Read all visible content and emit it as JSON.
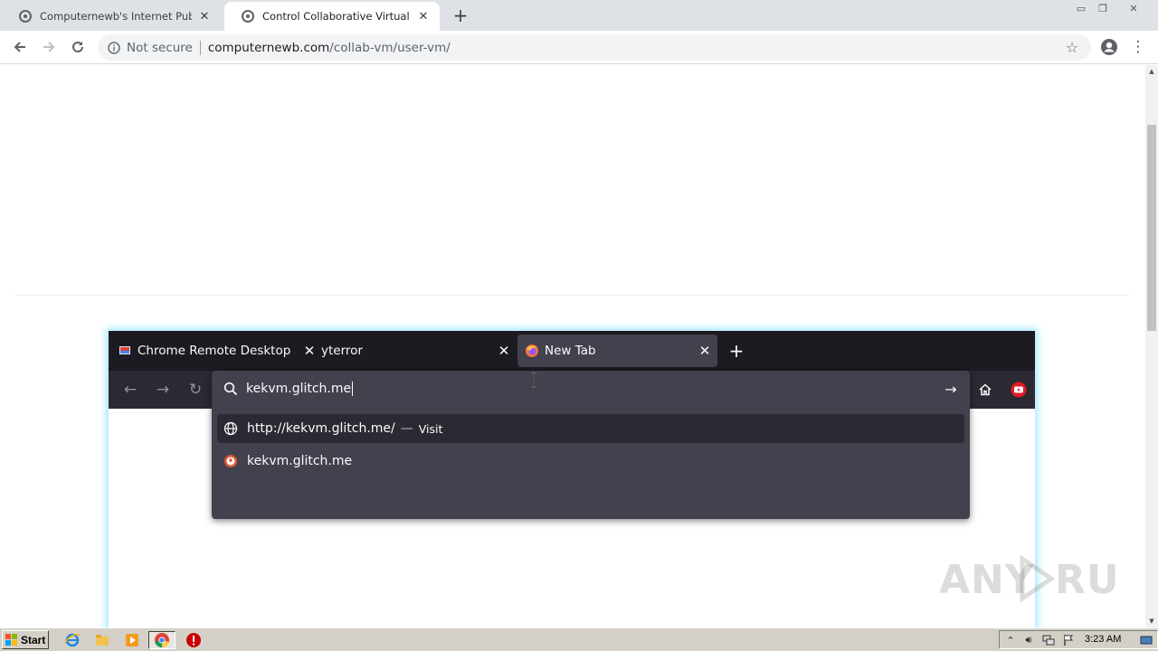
{
  "chrome": {
    "tabs": [
      {
        "title": "Computernewb's Internet Pub Hub",
        "active": false
      },
      {
        "title": "Control Collaborative Virtual Machine",
        "active": true
      }
    ],
    "security": "Not secure",
    "url_host": "computernewb.com",
    "url_path": "/collab-vm/user-vm/"
  },
  "vm": {
    "firefox": {
      "tabs": [
        {
          "title": "Chrome Remote Desktop"
        },
        {
          "title": "yterror"
        },
        {
          "title": "New Tab",
          "selected": true
        }
      ],
      "address_text": "kekvm.glitch.me",
      "suggestions": [
        {
          "text": "http://kekvm.glitch.me/",
          "action": "Visit"
        },
        {
          "text": "kekvm.glitch.me"
        }
      ]
    }
  },
  "taskbar": {
    "start_label": "Start",
    "clock": "3:23 AM"
  },
  "watermark": "ANY RUN",
  "colors": {
    "chrome_tabstrip": "#dee1e6",
    "firefox_dark": "#1c1b22",
    "firefox_toolbar": "#2b2a33",
    "vm_glow": "#a6e9ff",
    "taskbar": "#d4d0c8"
  }
}
